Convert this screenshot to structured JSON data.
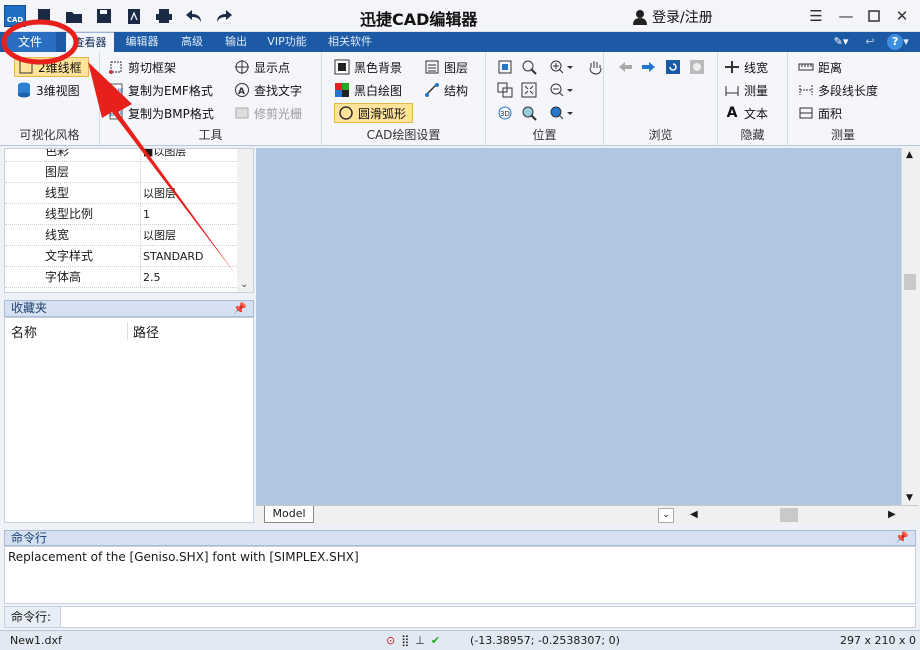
{
  "titlebar": {
    "app_title": "迅捷CAD编辑器",
    "login": "登录/注册",
    "logo_text": "CAD"
  },
  "tabs": {
    "file": "文件",
    "items": [
      "查看器",
      "编辑器",
      "高级",
      "输出",
      "VIP功能",
      "相关软件"
    ]
  },
  "ribbon": {
    "group1": {
      "label": "可视化风格",
      "btn_2d": "2维线框",
      "btn_3d": "3维视图"
    },
    "group2": {
      "label": "工具",
      "crop": "剪切框架",
      "copy_emf": "复制为EMF格式",
      "copy_bmp": "复制为BMP格式",
      "show_points": "显示点",
      "find_text": "查找文字",
      "trim_raster": "修剪光栅"
    },
    "group3": {
      "label": "CAD绘图设置",
      "black_bg": "黑色背景",
      "bw_draw": "黑白绘图",
      "smooth_arc": "圆滑弧形",
      "layers": "图层",
      "structure": "结构"
    },
    "group4": {
      "label": "位置"
    },
    "group5": {
      "label": "浏览"
    },
    "group6": {
      "label": "隐藏",
      "line_width": "线宽",
      "measure": "测量",
      "text": "文本"
    },
    "group7": {
      "label": "测量",
      "distance": "距离",
      "polyline_length": "多段线长度",
      "area": "面积"
    }
  },
  "properties": {
    "rows": [
      {
        "name": "色彩",
        "value": "■以图层"
      },
      {
        "name": "图层",
        "value": ""
      },
      {
        "name": "线型",
        "value": "以图层"
      },
      {
        "name": "线型比例",
        "value": "1"
      },
      {
        "name": "线宽",
        "value": "以图层"
      },
      {
        "name": "文字样式",
        "value": "STANDARD"
      },
      {
        "name": "字体高",
        "value": "2.5"
      }
    ]
  },
  "favorites": {
    "title": "收藏夹",
    "col_name": "名称",
    "col_path": "路径"
  },
  "canvas": {
    "model_tab": "Model"
  },
  "command": {
    "title": "命令行",
    "output": "Replacement of the [Geniso.SHX] font with [SIMPLEX.SHX]",
    "input_label": "命令行:"
  },
  "status": {
    "filename": "New1.dxf",
    "coords": "(-13.38957; -0.2538307; 0)",
    "paper": "297 x 210 x 0"
  },
  "colors": {
    "accent": "#1d5aa6",
    "canvas": "#b0c6e2",
    "annotation": "#e8201c"
  }
}
